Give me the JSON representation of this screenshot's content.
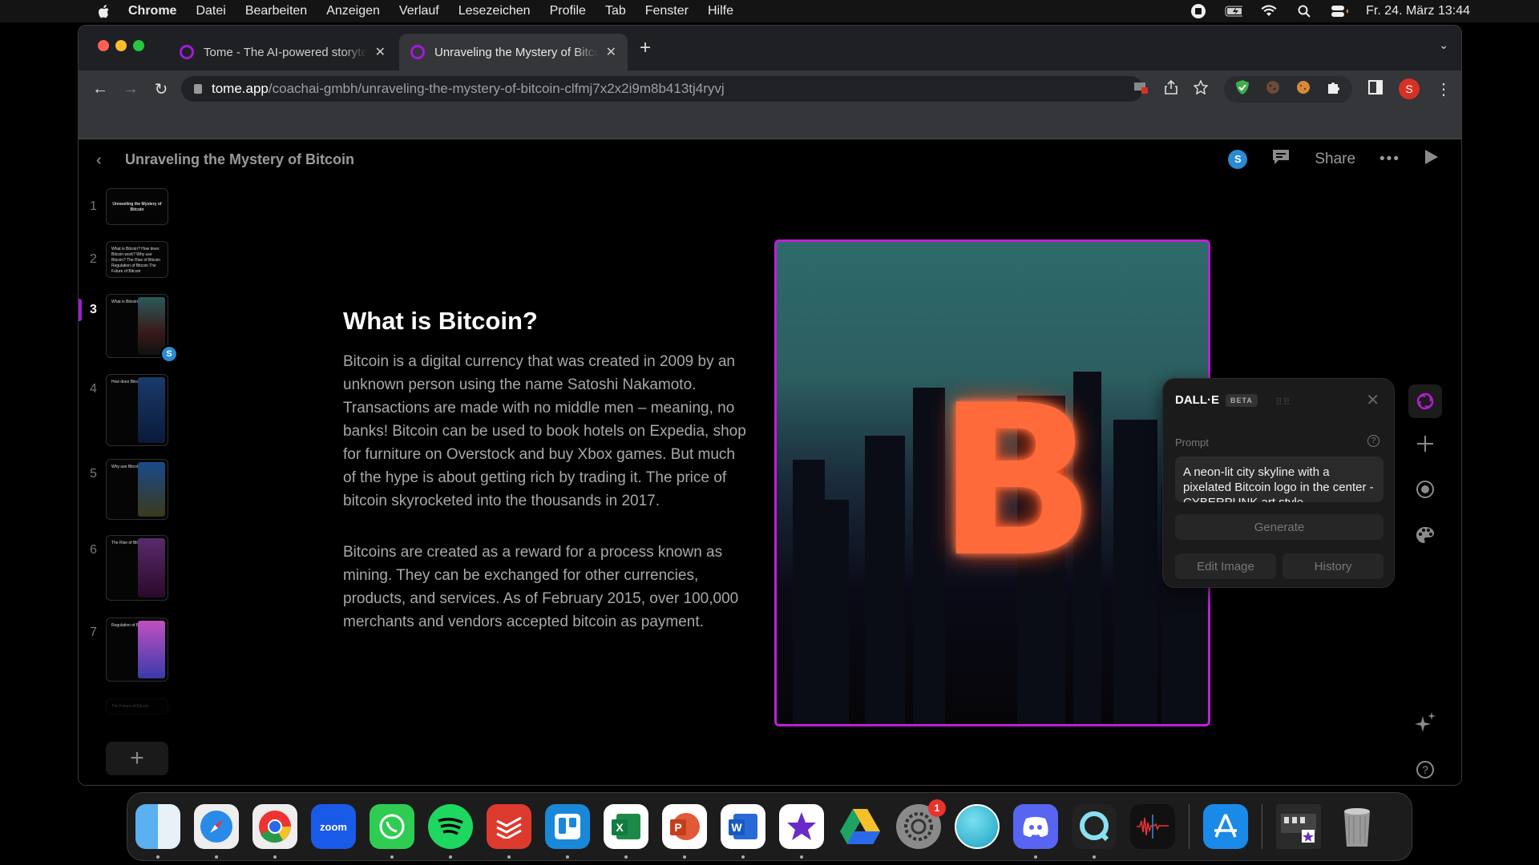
{
  "menubar": {
    "app": "Chrome",
    "items": [
      "Datei",
      "Bearbeiten",
      "Anzeigen",
      "Verlauf",
      "Lesezeichen",
      "Profile",
      "Tab",
      "Fenster",
      "Hilfe"
    ],
    "status_icons": [
      "screen-record-icon",
      "battery-charging-icon",
      "wifi-icon",
      "spotlight-search-icon",
      "control-center-icon"
    ],
    "datetime": "Fr. 24. März  13:44"
  },
  "browser": {
    "tabs": [
      {
        "title": "Tome - The AI-powered storytelling",
        "active": false
      },
      {
        "title": "Unraveling the Mystery of Bitcoin",
        "active": true
      }
    ],
    "url_host": "tome.app",
    "url_path": "/coachai-gmbh/unraveling-the-mystery-of-bitcoin-clfmj7x2x2i9m8b413tj4ryvj",
    "profile_initial": "S"
  },
  "app": {
    "doc_title": "Unraveling the Mystery of Bitcoin",
    "collaborator_initial": "S",
    "share_label": "Share",
    "more_label": "•••"
  },
  "thumbnails": [
    {
      "num": "1",
      "text": "Unraveling the Mystery of Bitcoin"
    },
    {
      "num": "2",
      "text": "What is Bitcoin? How does Bitcoin work? Why use Bitcoin? The Rise of Bitcoin Regulation of Bitcoin The Future of Bitcoin"
    },
    {
      "num": "3",
      "text": "What is Bitcoin?",
      "active": true,
      "badge": "S"
    },
    {
      "num": "4",
      "text": "How does Bitcoin work?"
    },
    {
      "num": "5",
      "text": "Why use Bitcoin?"
    },
    {
      "num": "6",
      "text": "The Rise of Bitcoin"
    },
    {
      "num": "7",
      "text": "Regulation of Bitcoin"
    },
    {
      "num": "8",
      "text": "The Future of Bitcoin"
    }
  ],
  "add_page_label": "+",
  "slide": {
    "title": "What is Bitcoin?",
    "paragraphs": [
      "Bitcoin is a digital currency that was created in 2009 by an unknown person using the name Satoshi Nakamoto. Transactions are made with no middle men – meaning, no banks! Bitcoin can be used to book hotels on Expedia, shop for furniture on Overstock and buy Xbox games. But much of the hype is about getting rich by trading it. The price of bitcoin skyrocketed into the thousands in 2017.",
      "Bitcoins are created as a reward for a process known as mining. They can be exchanged for other currencies, products, and services. As of February 2015, over 100,000 merchants and vendors accepted bitcoin as payment."
    ],
    "image_glyph": "B"
  },
  "dalle": {
    "name": "DALL·E",
    "beta": "BETA",
    "prompt_label": "Prompt",
    "prompt_value": "A neon-lit city skyline with a pixelated Bitcoin logo in the center - CYBERPUNK art style",
    "generate_label": "Generate",
    "edit_label": "Edit Image",
    "history_label": "History"
  },
  "dock": {
    "apps": [
      "Finder",
      "Safari",
      "Chrome",
      "Zoom",
      "WhatsApp",
      "Spotify",
      "Todoist",
      "Trello",
      "Excel",
      "PowerPoint",
      "Word",
      "iMovie",
      "Google Drive",
      "System Settings",
      "Mirror",
      "Discord",
      "QuickTime",
      "Voice Memos",
      "App Store",
      "Downloads",
      "Trash"
    ],
    "zoom_label": "zoom",
    "settings_badge": "1"
  },
  "colors": {
    "accent": "#a21ad6",
    "avatar": "#2a8ad4",
    "profile": "#d93025"
  }
}
